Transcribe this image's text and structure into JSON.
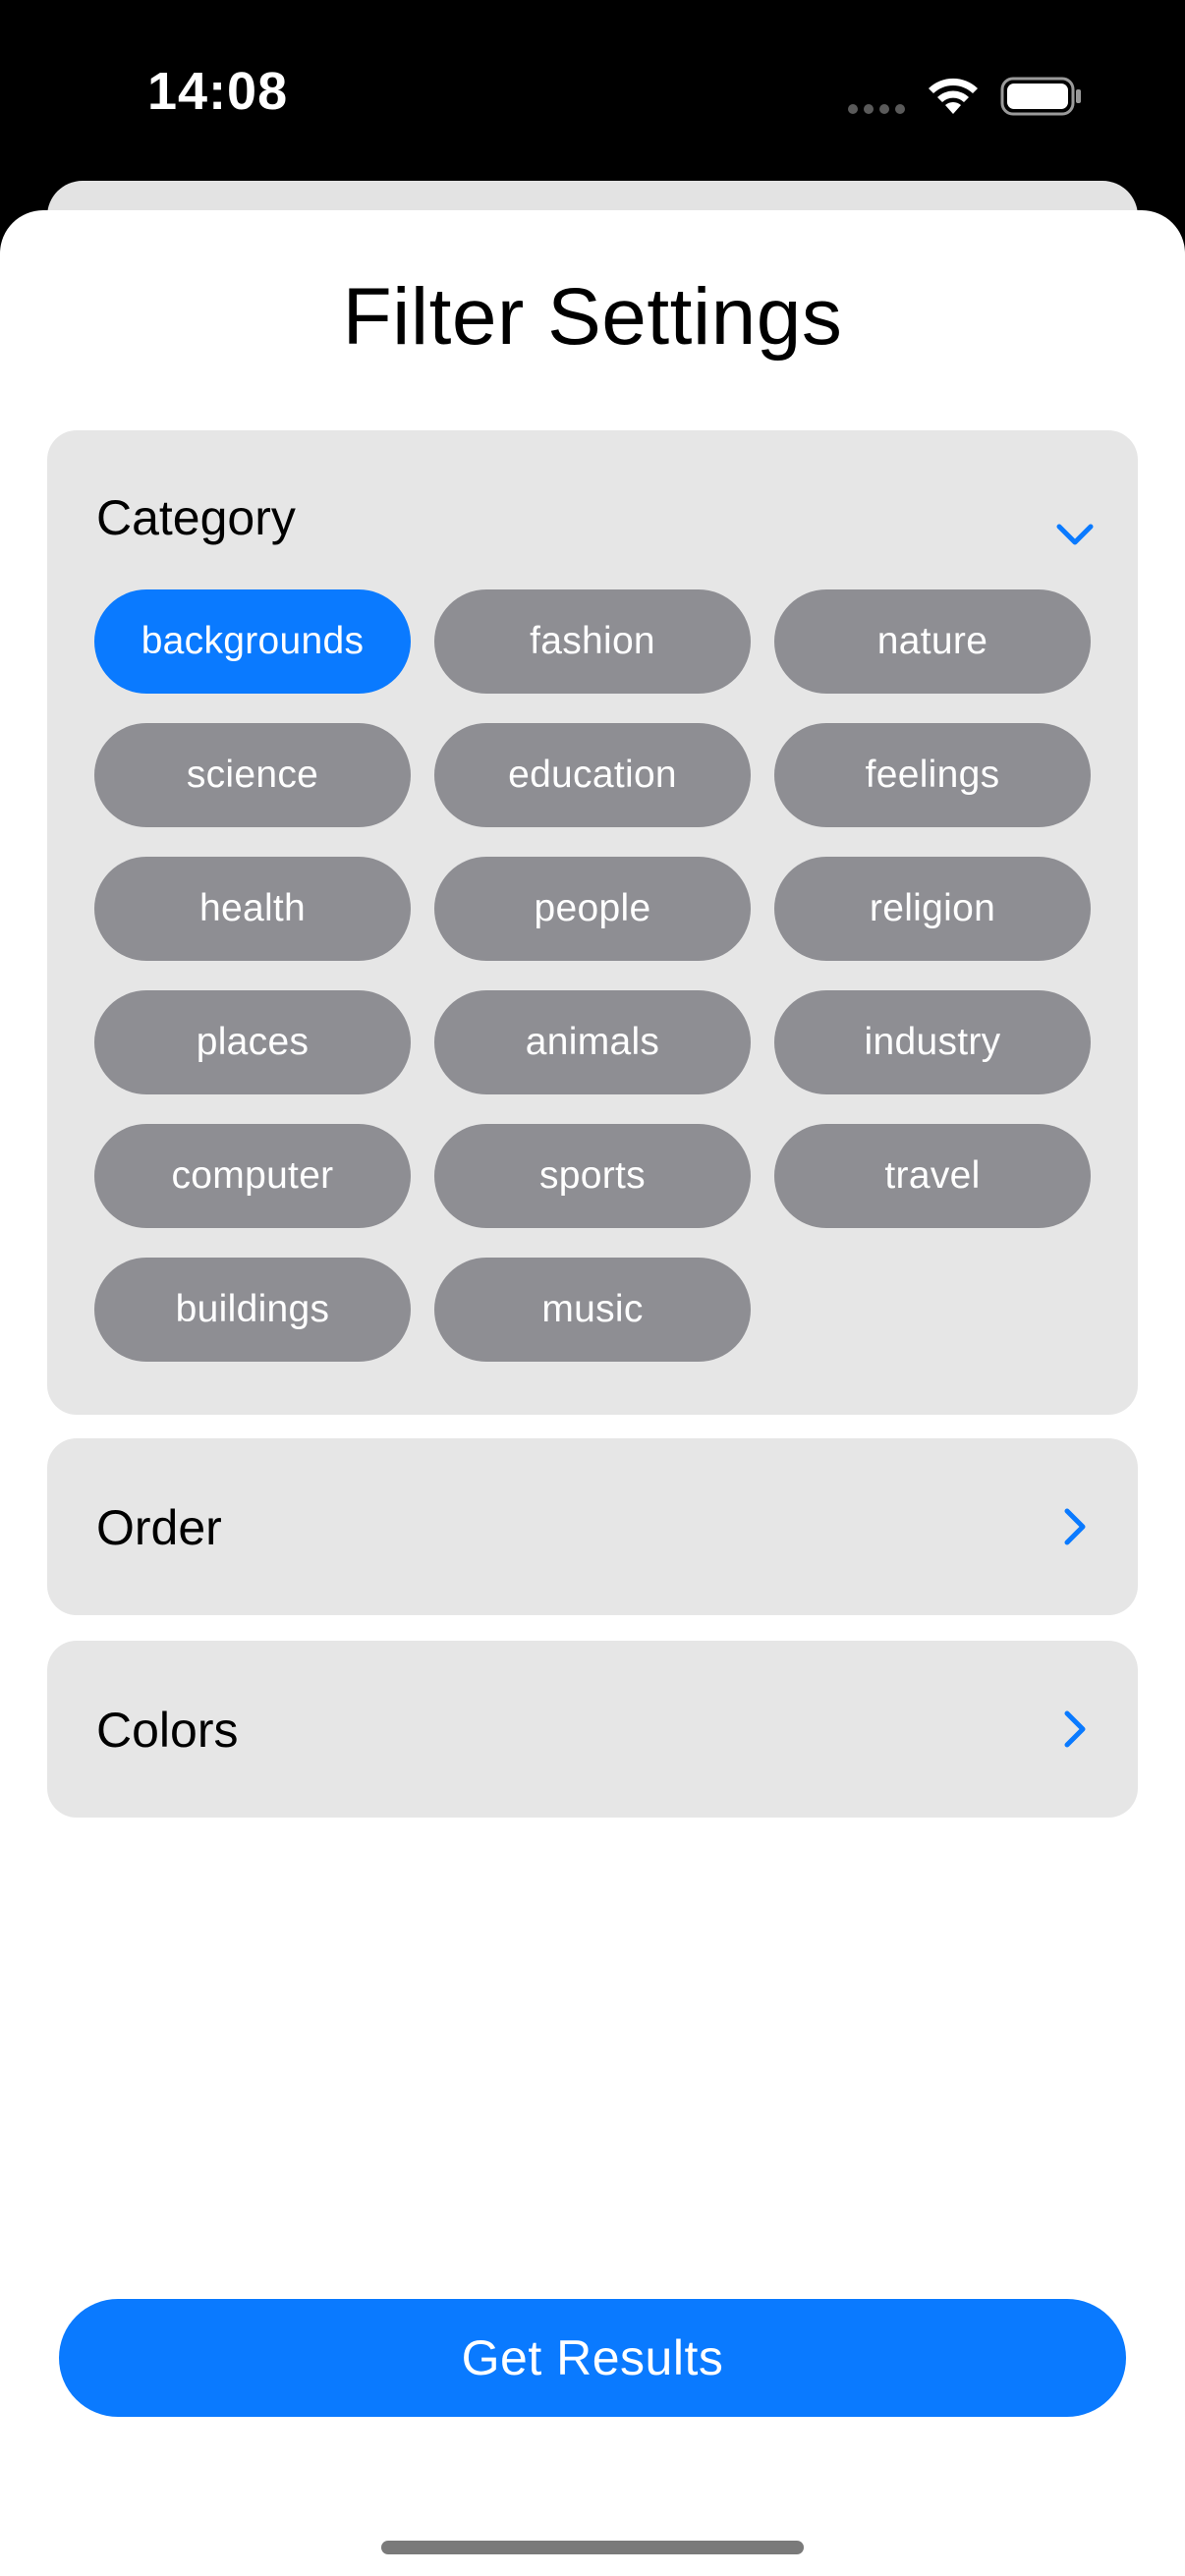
{
  "status_bar": {
    "time": "14:08"
  },
  "sheet": {
    "title": "Filter Settings"
  },
  "sections": {
    "category": {
      "label": "Category",
      "chips": [
        {
          "label": "backgrounds",
          "selected": true
        },
        {
          "label": "fashion",
          "selected": false
        },
        {
          "label": "nature",
          "selected": false
        },
        {
          "label": "science",
          "selected": false
        },
        {
          "label": "education",
          "selected": false
        },
        {
          "label": "feelings",
          "selected": false
        },
        {
          "label": "health",
          "selected": false
        },
        {
          "label": "people",
          "selected": false
        },
        {
          "label": "religion",
          "selected": false
        },
        {
          "label": "places",
          "selected": false
        },
        {
          "label": "animals",
          "selected": false
        },
        {
          "label": "industry",
          "selected": false
        },
        {
          "label": "computer",
          "selected": false
        },
        {
          "label": "sports",
          "selected": false
        },
        {
          "label": "travel",
          "selected": false
        },
        {
          "label": "buildings",
          "selected": false
        },
        {
          "label": "music",
          "selected": false
        }
      ]
    },
    "order": {
      "label": "Order"
    },
    "colors": {
      "label": "Colors"
    }
  },
  "actions": {
    "get_results_label": "Get Results"
  },
  "theme": {
    "accent": "#0a7aff",
    "chip_default": "#8e8e93",
    "section_bg": "#e6e6e6"
  }
}
